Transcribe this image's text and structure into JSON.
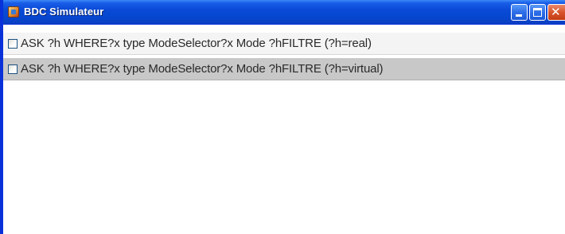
{
  "window": {
    "title": "BDC Simulateur",
    "icon": "java-app-icon",
    "controls": {
      "minimize_icon": "minimize-icon",
      "maximize_icon": "maximize-icon",
      "close_icon": "close-icon",
      "close_glyph": "✕"
    }
  },
  "list": {
    "items": [
      {
        "label": "ASK ?h WHERE?x type ModeSelector?x Mode ?hFILTRE (?h=real)",
        "checked": false,
        "selected": false
      },
      {
        "label": "ASK ?h WHERE?x type ModeSelector?x Mode ?hFILTRE (?h=virtual)",
        "checked": false,
        "selected": true
      }
    ]
  },
  "colors": {
    "titlebar": "#0a4ad6",
    "window_border": "#0831d9",
    "selected_row": "#c8c8c8",
    "close_button": "#d9542b"
  }
}
